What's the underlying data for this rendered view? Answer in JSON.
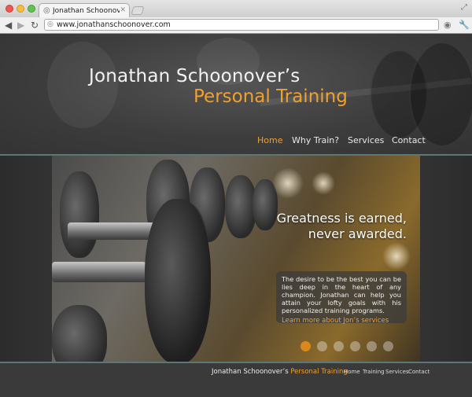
{
  "browser": {
    "tab_title": "Jonathan Schoonover Perso",
    "tab_close": "✕",
    "url": "www.jonathanschoonover.com",
    "back": "◀",
    "forward": "▶",
    "reload": "↻",
    "traffic_lights": {
      "close": "#ee5a52",
      "minimize": "#f4bd41",
      "zoom": "#62c254"
    }
  },
  "site": {
    "title_line1": "Jonathan Schoonover’s",
    "title_line2": "Personal Training",
    "accent_color": "#f0a030",
    "nav": [
      {
        "label": "Home",
        "active": true
      },
      {
        "label": "Why Train?"
      },
      {
        "label": "Services"
      },
      {
        "label": "Contact"
      }
    ]
  },
  "hero": {
    "headline_line1": "Greatness is earned,",
    "headline_line2": "never awarded.",
    "body": "The desire to be the best you can be lies deep in the heart of any champion. Jonathan can help you attain your lofty goals with his personalized training programs.",
    "link": "Learn more about Jon’s services",
    "slides": 6,
    "active_slide": 1
  },
  "footer": {
    "brand_white": "Jonathan Schoonover’s",
    "brand_orange": "Personal Training",
    "links": [
      "Home",
      "Training",
      "Services",
      "Contact"
    ]
  }
}
